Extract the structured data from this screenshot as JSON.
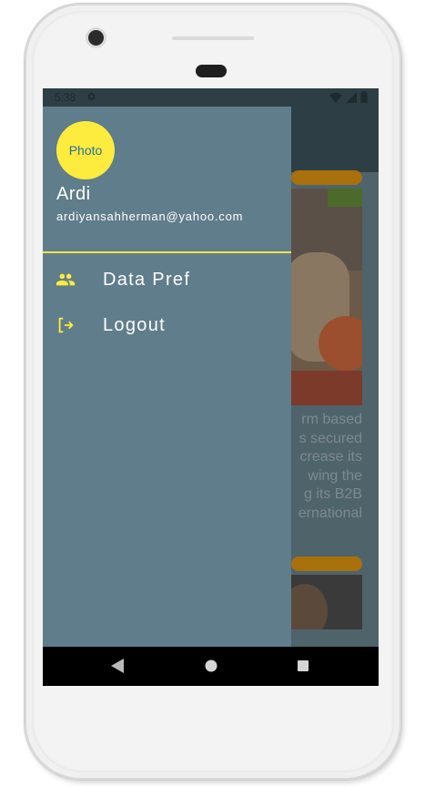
{
  "status_bar": {
    "time": "5:38"
  },
  "background_content": {
    "text_lines": [
      "rm based",
      "s secured",
      "crease its",
      "wing   the",
      "g  its  B2B",
      "ernational"
    ]
  },
  "drawer": {
    "avatar_label": "Photo",
    "user_name": "Ardi",
    "user_email": "ardiyansahherman@yahoo.com",
    "accent_color": "#fdeb3d",
    "background_color": "#607d8b",
    "menu": [
      {
        "label": "Data Pref",
        "icon": "people-icon"
      },
      {
        "label": "Logout",
        "icon": "logout-icon"
      }
    ]
  },
  "navigation_bar": {
    "buttons": [
      "back-icon",
      "home-icon",
      "recents-icon"
    ]
  }
}
